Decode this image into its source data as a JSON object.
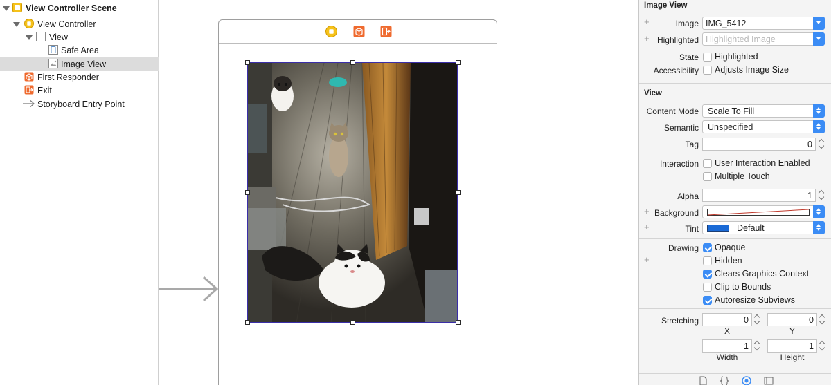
{
  "outline": {
    "items": [
      {
        "label": "View Controller Scene",
        "icon": "scene-icon"
      },
      {
        "label": "View Controller",
        "icon": "view-controller-icon"
      },
      {
        "label": "View",
        "icon": "view-icon"
      },
      {
        "label": "Safe Area",
        "icon": "safe-area-icon"
      },
      {
        "label": "Image View",
        "icon": "image-view-icon"
      },
      {
        "label": "First Responder",
        "icon": "first-responder-icon"
      },
      {
        "label": "Exit",
        "icon": "exit-icon"
      },
      {
        "label": "Storyboard Entry Point",
        "icon": "entry-arrow-icon"
      }
    ]
  },
  "canvas": {
    "scene_bar_icons": [
      "view-controller-icon",
      "first-responder-icon",
      "exit-icon"
    ],
    "image_description_icon": "cats-photo"
  },
  "inspector": {
    "image_view": {
      "title": "Image View",
      "image_label": "Image",
      "image_value": "IMG_5412",
      "highlighted_label": "Highlighted",
      "highlighted_placeholder": "Highlighted Image",
      "state_label": "State",
      "state_checkbox_label": "Highlighted",
      "state_checked": false,
      "accessibility_label": "Accessibility",
      "accessibility_checkbox_label": "Adjusts Image Size",
      "accessibility_checked": false
    },
    "view": {
      "title": "View",
      "content_mode_label": "Content Mode",
      "content_mode_value": "Scale To Fill",
      "semantic_label": "Semantic",
      "semantic_value": "Unspecified",
      "tag_label": "Tag",
      "tag_value": "0",
      "interaction_label": "Interaction",
      "user_interaction_label": "User Interaction Enabled",
      "user_interaction_checked": false,
      "multiple_touch_label": "Multiple Touch",
      "multiple_touch_checked": false,
      "alpha_label": "Alpha",
      "alpha_value": "1",
      "background_label": "Background",
      "tint_label": "Tint",
      "tint_value": "Default",
      "tint_color": "#1a6ad6",
      "drawing_label": "Drawing",
      "opaque_label": "Opaque",
      "opaque_checked": true,
      "hidden_label": "Hidden",
      "hidden_checked": false,
      "clears_label": "Clears Graphics Context",
      "clears_checked": true,
      "clip_label": "Clip to Bounds",
      "clip_checked": false,
      "autoresize_label": "Autoresize Subviews",
      "autoresize_checked": true,
      "stretching_label": "Stretching",
      "stretch_x": "0",
      "stretch_y": "0",
      "x_label": "X",
      "y_label": "Y",
      "stretch_width": "1",
      "stretch_height": "1",
      "width_label": "Width",
      "height_label": "Height"
    },
    "accent_color": "#3b8cf5"
  }
}
